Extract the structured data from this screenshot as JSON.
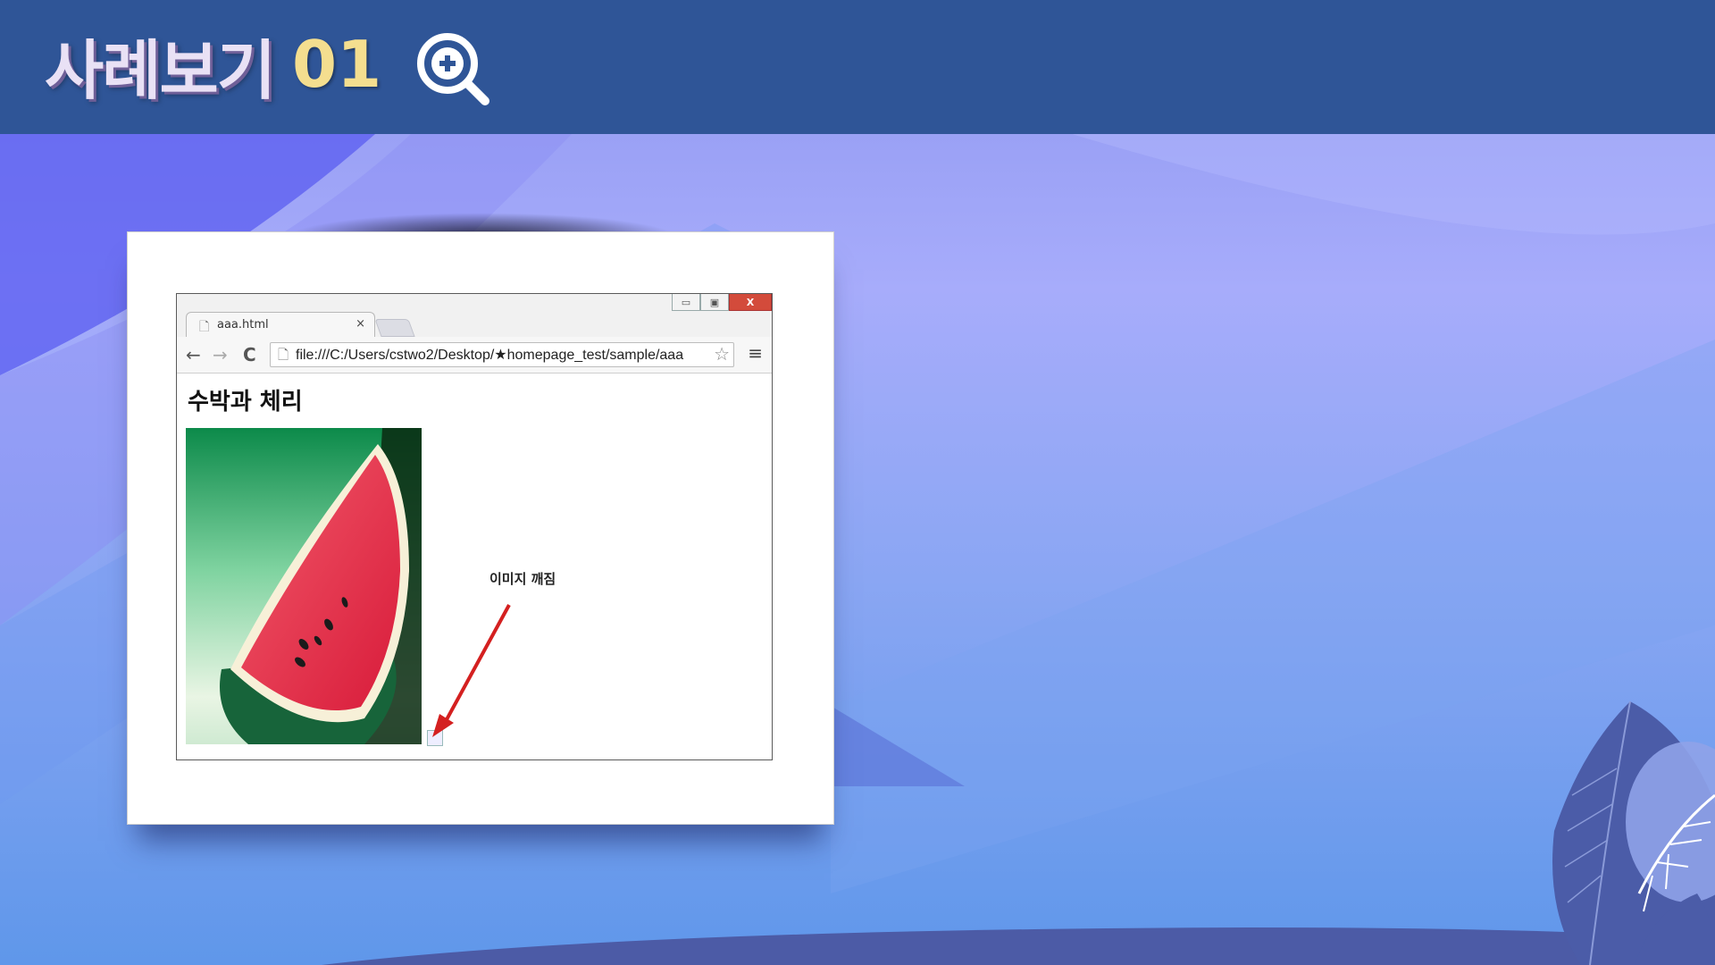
{
  "header": {
    "title": "사례보기",
    "number": "01",
    "icon": "zoom-in-icon"
  },
  "browser": {
    "tab_label": "aaa.html",
    "tab_close": "×",
    "url": "file:///C:/Users/cstwo2/Desktop/★homepage_test/sample/aaa",
    "window_controls": {
      "minimize": "▭",
      "restore": "▣",
      "close": "X"
    },
    "nav": {
      "back": "←",
      "forward": "→",
      "reload": "C",
      "menu": "≡",
      "star": "☆"
    }
  },
  "page": {
    "heading": "수박과 체리",
    "annotation": "이미지 깨짐"
  },
  "colors": {
    "header_bg": "#2f5597",
    "title_text": "#e9e1f5",
    "title_number": "#f4de8f",
    "arrow": "#d42020"
  }
}
